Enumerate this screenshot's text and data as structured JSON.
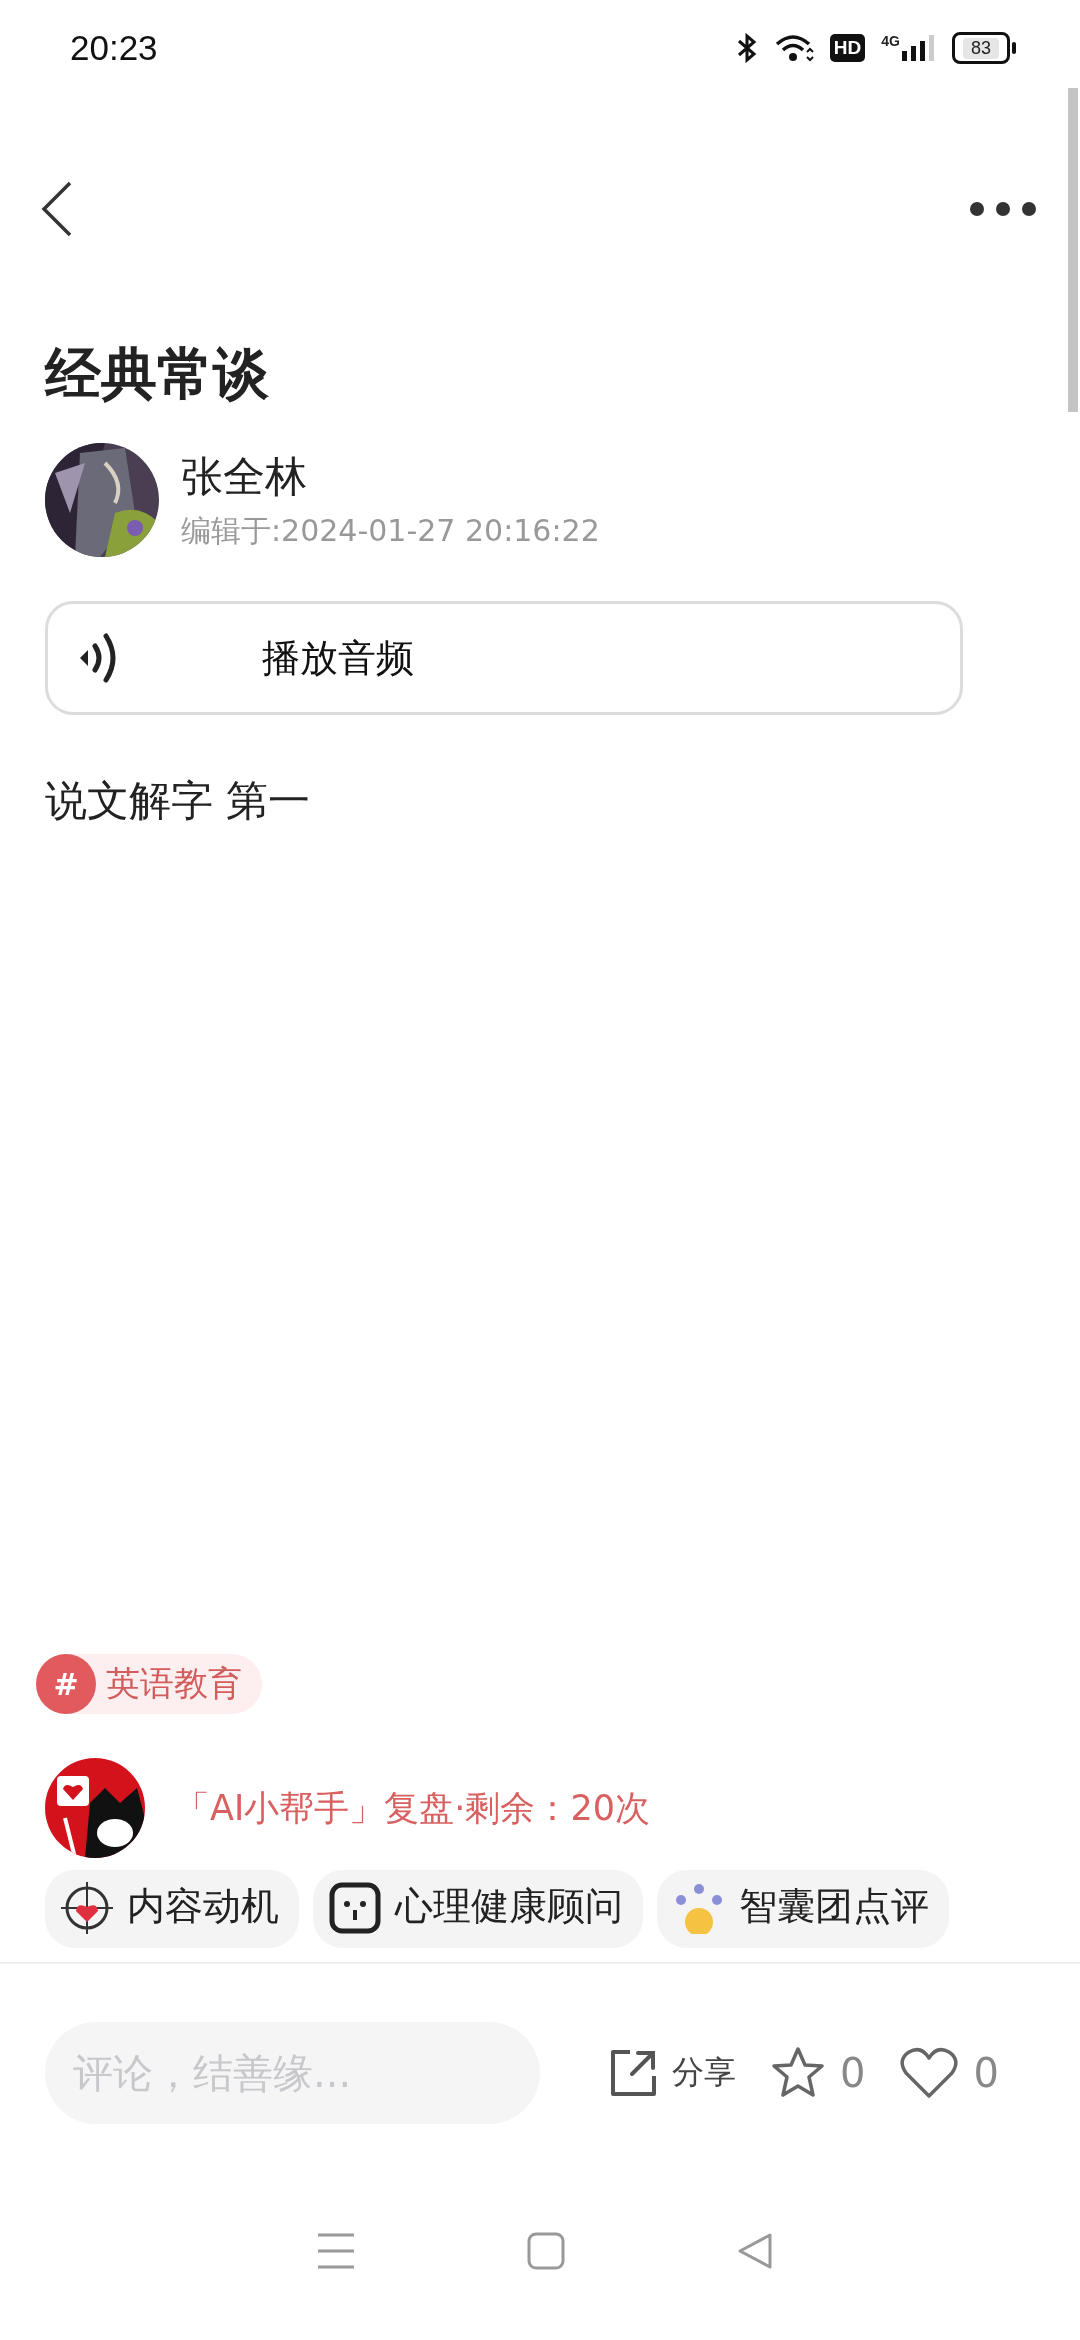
{
  "status_bar": {
    "time": "20:23",
    "hd": "HD",
    "network": "4G",
    "battery": "83"
  },
  "header": {
    "title": "经典常谈"
  },
  "author": {
    "name": "张全林",
    "edited": "编辑于:2024-01-27 20:16:22"
  },
  "audio_button": {
    "label": "播放音频"
  },
  "body": "说文解字 第一",
  "tags": [
    {
      "symbol": "#",
      "label": "英语教育"
    }
  ],
  "ai_helper": {
    "text": "「AI小帮手」复盘·剩余：20次",
    "chips": [
      {
        "label": "内容动机",
        "kind": "target"
      },
      {
        "label": "心理健康顾问",
        "kind": "face"
      },
      {
        "label": "智囊团点评",
        "kind": "team"
      }
    ]
  },
  "bottom_bar": {
    "comment_placeholder": "评论，结善缘...",
    "share": "分享",
    "favorites": "0",
    "likes": "0"
  }
}
